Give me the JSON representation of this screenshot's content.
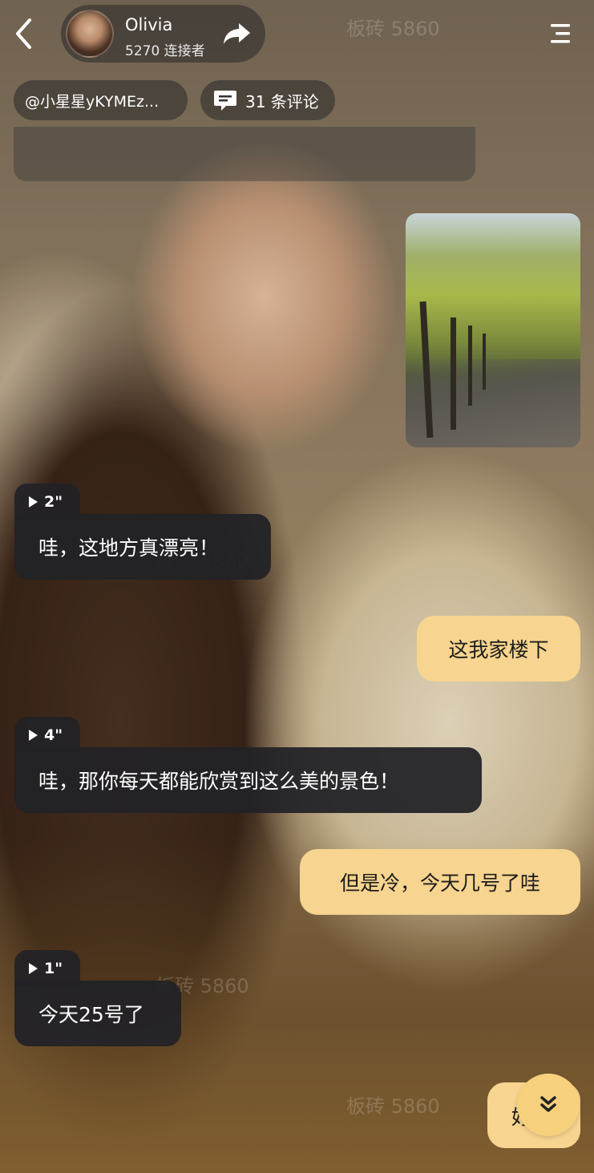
{
  "header": {
    "profile_name": "Olivia",
    "followers": "5270 连接者",
    "user_tag": "@小星星yKYMEz...",
    "comments": "31 条评论"
  },
  "messages": [
    {
      "role": "ai",
      "duration": "2\"",
      "text": "哇，这地方真漂亮！"
    },
    {
      "role": "user",
      "text": "这我家楼下"
    },
    {
      "role": "ai",
      "duration": "4\"",
      "text": "哇，那你每天都能欣赏到这么美的景色！"
    },
    {
      "role": "user",
      "text": "但是冷，今天几号了哇"
    },
    {
      "role": "ai",
      "duration": "1\"",
      "text": "今天25号了"
    }
  ],
  "bottom": {
    "partial_text": "好"
  },
  "watermark": "板砖 5860",
  "colors": {
    "user_bubble": "#f7d48f",
    "ai_bubble": "#222226"
  },
  "icons": {
    "back": "back-icon",
    "share": "share-icon",
    "menu": "menu-icon",
    "comment": "comment-icon",
    "play": "play-icon",
    "scroll": "chevron-double-down-icon"
  }
}
